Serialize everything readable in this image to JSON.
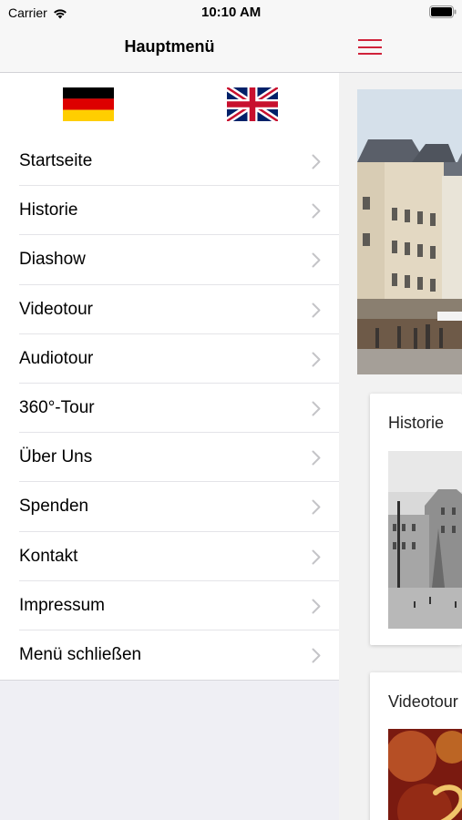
{
  "status_bar": {
    "carrier": "Carrier",
    "time": "10:10 AM"
  },
  "menu": {
    "title": "Hauptmenü",
    "flags": [
      {
        "name": "flag-germany-icon",
        "lang": "de"
      },
      {
        "name": "flag-uk-icon",
        "lang": "en"
      }
    ],
    "items": [
      {
        "label": "Startseite"
      },
      {
        "label": "Historie"
      },
      {
        "label": "Diashow"
      },
      {
        "label": "Videotour"
      },
      {
        "label": "Audiotour"
      },
      {
        "label": "360°-Tour"
      },
      {
        "label": "Über Uns"
      },
      {
        "label": "Spenden"
      },
      {
        "label": "Kontakt"
      },
      {
        "label": "Impressum"
      },
      {
        "label": "Menü schließen"
      }
    ]
  },
  "main": {
    "cards": [
      {
        "title": "Historie"
      },
      {
        "title": "Videotour"
      }
    ]
  },
  "colors": {
    "accent": "#d0223a"
  }
}
